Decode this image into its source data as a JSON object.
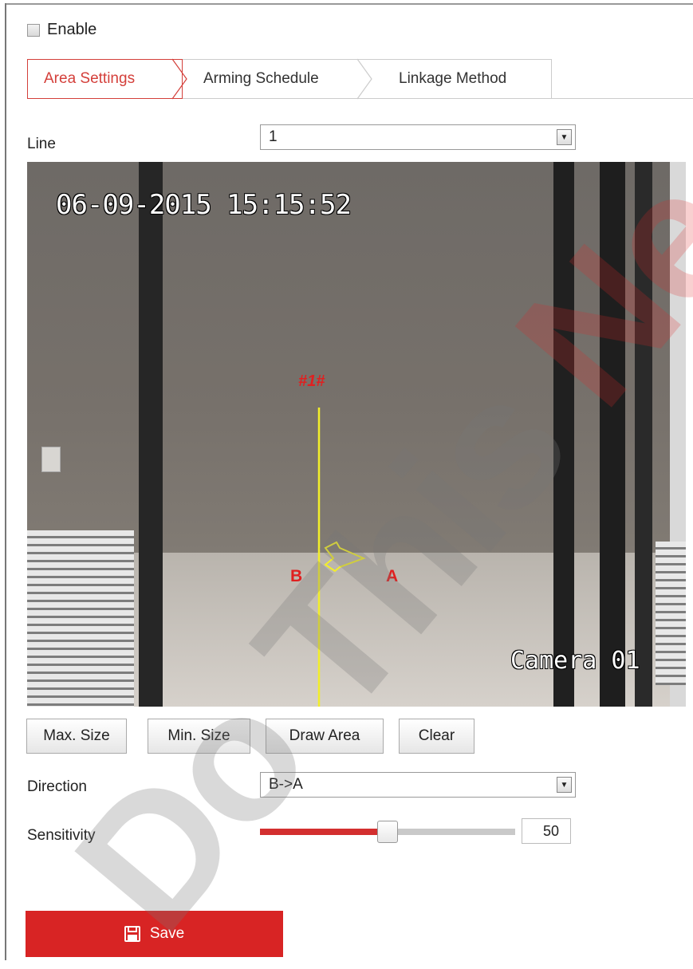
{
  "enable": {
    "label": "Enable",
    "checked": false
  },
  "tabs": [
    {
      "label": "Area Settings",
      "active": true
    },
    {
      "label": "Arming Schedule",
      "active": false
    },
    {
      "label": "Linkage Method",
      "active": false
    }
  ],
  "line": {
    "label": "Line",
    "value": "1"
  },
  "video": {
    "timestamp": "06-09-2015 15:15:52",
    "camera_name": "Camera 01",
    "rule_label": "#1#",
    "side_a": "A",
    "side_b": "B"
  },
  "buttons": {
    "max_size": "Max. Size",
    "min_size": "Min. Size",
    "draw_area": "Draw Area",
    "clear": "Clear"
  },
  "direction": {
    "label": "Direction",
    "value": "B->A"
  },
  "sensitivity": {
    "label": "Sensitivity",
    "value": 50,
    "value_text": "50",
    "max": 100
  },
  "save": {
    "label": "Save"
  },
  "watermark": {
    "text_dark": "Do This ",
    "text_red": "Ne"
  },
  "colors": {
    "accent": "#d82424",
    "overlay_line": "#f2ee2a",
    "overlay_text": "#e02020"
  },
  "icons": {
    "save": "floppy-disk-icon",
    "dropdown": "chevron-down-icon"
  }
}
